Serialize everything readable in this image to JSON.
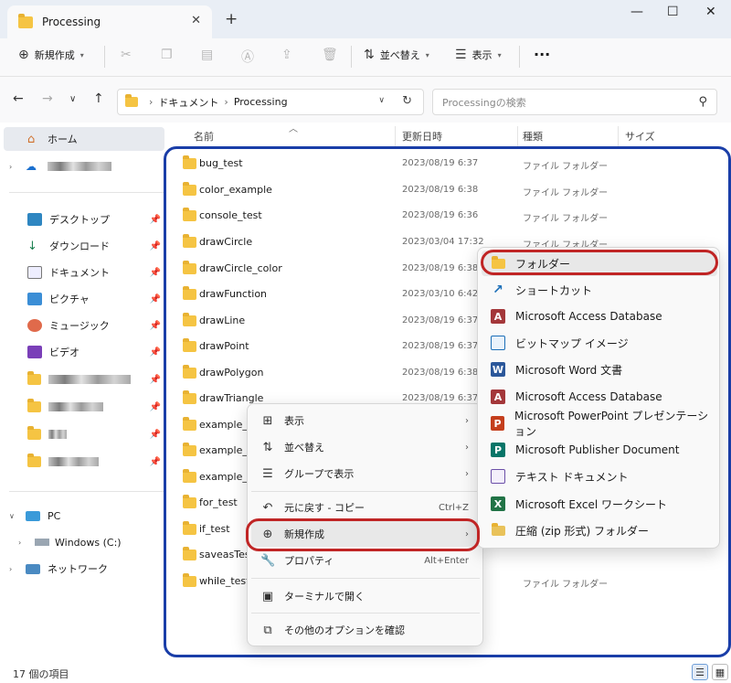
{
  "window": {
    "tab_title": "Processing",
    "tab_close": "✕",
    "new_tab": "+",
    "minimize": "—",
    "maximize": "☐",
    "close": "✕"
  },
  "commandbar": {
    "new_label": "新規作成",
    "sort_label": "並べ替え",
    "view_label": "表示",
    "more": "···"
  },
  "address": {
    "path": [
      "ドキュメント",
      "Processing"
    ],
    "search_placeholder": "Processingの検索"
  },
  "sidebar": {
    "home": "ホーム",
    "quick": [
      "デスクトップ",
      "ダウンロード",
      "ドキュメント",
      "ピクチャ",
      "ミュージック",
      "ビデオ"
    ],
    "pc": "PC",
    "drive": "Windows (C:)",
    "network": "ネットワーク"
  },
  "columns": {
    "name": "名前",
    "date": "更新日時",
    "type": "種類",
    "size": "サイズ"
  },
  "files": [
    {
      "name": "bug_test",
      "date": "2023/08/19 6:37",
      "type": "ファイル フォルダー"
    },
    {
      "name": "color_example",
      "date": "2023/08/19 6:38",
      "type": "ファイル フォルダー"
    },
    {
      "name": "console_test",
      "date": "2023/08/19 6:36",
      "type": "ファイル フォルダー"
    },
    {
      "name": "drawCircle",
      "date": "2023/03/04 17:32",
      "type": "ファイル フォルダー"
    },
    {
      "name": "drawCircle_color",
      "date": "2023/08/19 6:38",
      "type": "ファイル フォルダー"
    },
    {
      "name": "drawFunction",
      "date": "2023/03/10 6:42",
      "type": "ファイル フォルダー"
    },
    {
      "name": "drawLine",
      "date": "2023/08/19 6:37",
      "type": "ファイル フォルダー"
    },
    {
      "name": "drawPoint",
      "date": "2023/08/19 6:37",
      "type": "ファイル フォルダー"
    },
    {
      "name": "drawPolygon",
      "date": "2023/08/19 6:38",
      "type": "ファイル フォルダー"
    },
    {
      "name": "drawTriangle",
      "date": "2023/08/19 6:37",
      "type": "ファイル フォルダー"
    },
    {
      "name": "example_a",
      "date": "",
      "type": ""
    },
    {
      "name": "example_A",
      "date": "",
      "type": ""
    },
    {
      "name": "example_v",
      "date": "",
      "type": ""
    },
    {
      "name": "for_test",
      "date": "",
      "type": ""
    },
    {
      "name": "if_test",
      "date": "",
      "type": ""
    },
    {
      "name": "saveasTest",
      "date": "",
      "type": ""
    },
    {
      "name": "while_test",
      "date": "",
      "type": "ファイル フォルダー"
    }
  ],
  "context_menu": {
    "view": "表示",
    "sort": "並べ替え",
    "group": "グループで表示",
    "undo": "元に戻す - コピー",
    "undo_shortcut": "Ctrl+Z",
    "new": "新規作成",
    "properties": "プロパティ",
    "properties_shortcut": "Alt+Enter",
    "terminal": "ターミナルで開く",
    "more_options": "その他のオプションを確認"
  },
  "submenu": [
    "フォルダー",
    "ショートカット",
    "Microsoft Access Database",
    "ビットマップ イメージ",
    "Microsoft Word 文書",
    "Microsoft Access Database",
    "Microsoft PowerPoint プレゼンテーション",
    "Microsoft Publisher Document",
    "テキスト ドキュメント",
    "Microsoft Excel ワークシート",
    "圧縮 (zip 形式) フォルダー"
  ],
  "status": {
    "count": "17 個の項目"
  },
  "colors": {
    "highlight_blue": "#1a3ea8",
    "highlight_red": "#c02525",
    "folder": "#f5c443"
  }
}
